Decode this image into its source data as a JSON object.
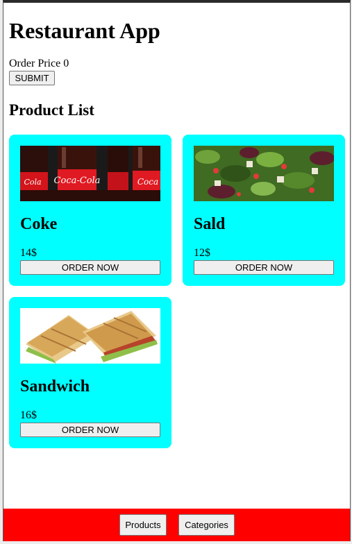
{
  "app": {
    "title": "Restaurant App"
  },
  "order": {
    "label": "Order Price",
    "price": "0",
    "submit_label": "SUBMIT"
  },
  "products": {
    "heading": "Product List",
    "items": [
      {
        "name": "Coke",
        "price": "14$",
        "button": "ORDER NOW",
        "image": "coke-bottles-image"
      },
      {
        "name": "Sald",
        "price": "12$",
        "button": "ORDER NOW",
        "image": "salad-image"
      },
      {
        "name": "Sandwich",
        "price": "16$",
        "button": "ORDER NOW",
        "image": "sandwich-image"
      }
    ]
  },
  "footer": {
    "products_label": "Products",
    "categories_label": "Categories"
  },
  "colors": {
    "card_bg": "#00ffff",
    "footer_bg": "#ff0000"
  }
}
